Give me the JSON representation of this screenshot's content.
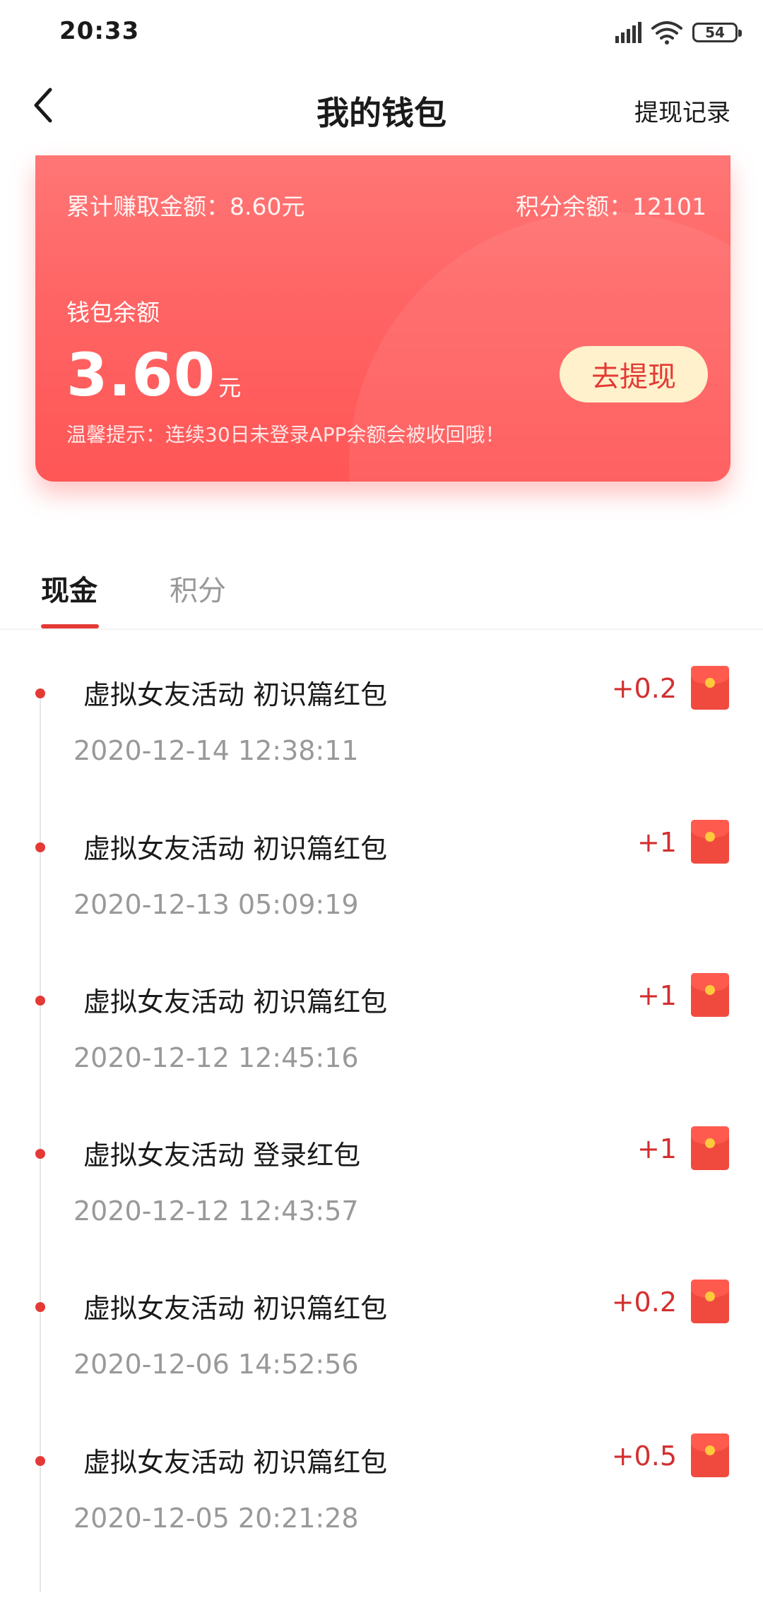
{
  "status_bar": {
    "time": "20:33",
    "battery": "54",
    "icons": [
      "signal-icon",
      "wifi-icon",
      "battery-icon"
    ]
  },
  "header": {
    "title": "我的钱包",
    "back_icon": "chevron-left-icon",
    "right_action": "提现记录"
  },
  "wallet": {
    "total_earned": "累计赚取金额：8.60元",
    "points_balance": "积分余额：12101",
    "balance_label": "钱包余额",
    "balance_value": "3.60",
    "balance_unit": "元",
    "withdraw_label": "去提现",
    "tip": "温馨提示：连续30日未登录APP余额会被收回哦！",
    "colors": {
      "card_top": "#ff7676",
      "card_bottom": "#ff5656",
      "button_bg": "#fff1cc",
      "button_text": "#e53935"
    }
  },
  "tabs": [
    {
      "label": "现金",
      "active": true
    },
    {
      "label": "积分",
      "active": false
    }
  ],
  "transactions": [
    {
      "title": "虚拟女友活动 初识篇红包",
      "time": "2020-12-14 12:38:11",
      "amount": "+0.2",
      "icon": "red-packet-icon"
    },
    {
      "title": "虚拟女友活动 初识篇红包",
      "time": "2020-12-13 05:09:19",
      "amount": "+1",
      "icon": "red-packet-icon"
    },
    {
      "title": "虚拟女友活动 初识篇红包",
      "time": "2020-12-12 12:45:16",
      "amount": "+1",
      "icon": "red-packet-icon"
    },
    {
      "title": "虚拟女友活动 登录红包",
      "time": "2020-12-12 12:43:57",
      "amount": "+1",
      "icon": "red-packet-icon"
    },
    {
      "title": "虚拟女友活动 初识篇红包",
      "time": "2020-12-06 14:52:56",
      "amount": "+0.2",
      "icon": "red-packet-icon"
    },
    {
      "title": "虚拟女友活动 初识篇红包",
      "time": "2020-12-05 20:21:28",
      "amount": "+0.5",
      "icon": "red-packet-icon"
    }
  ],
  "accent_color": "#e53935"
}
